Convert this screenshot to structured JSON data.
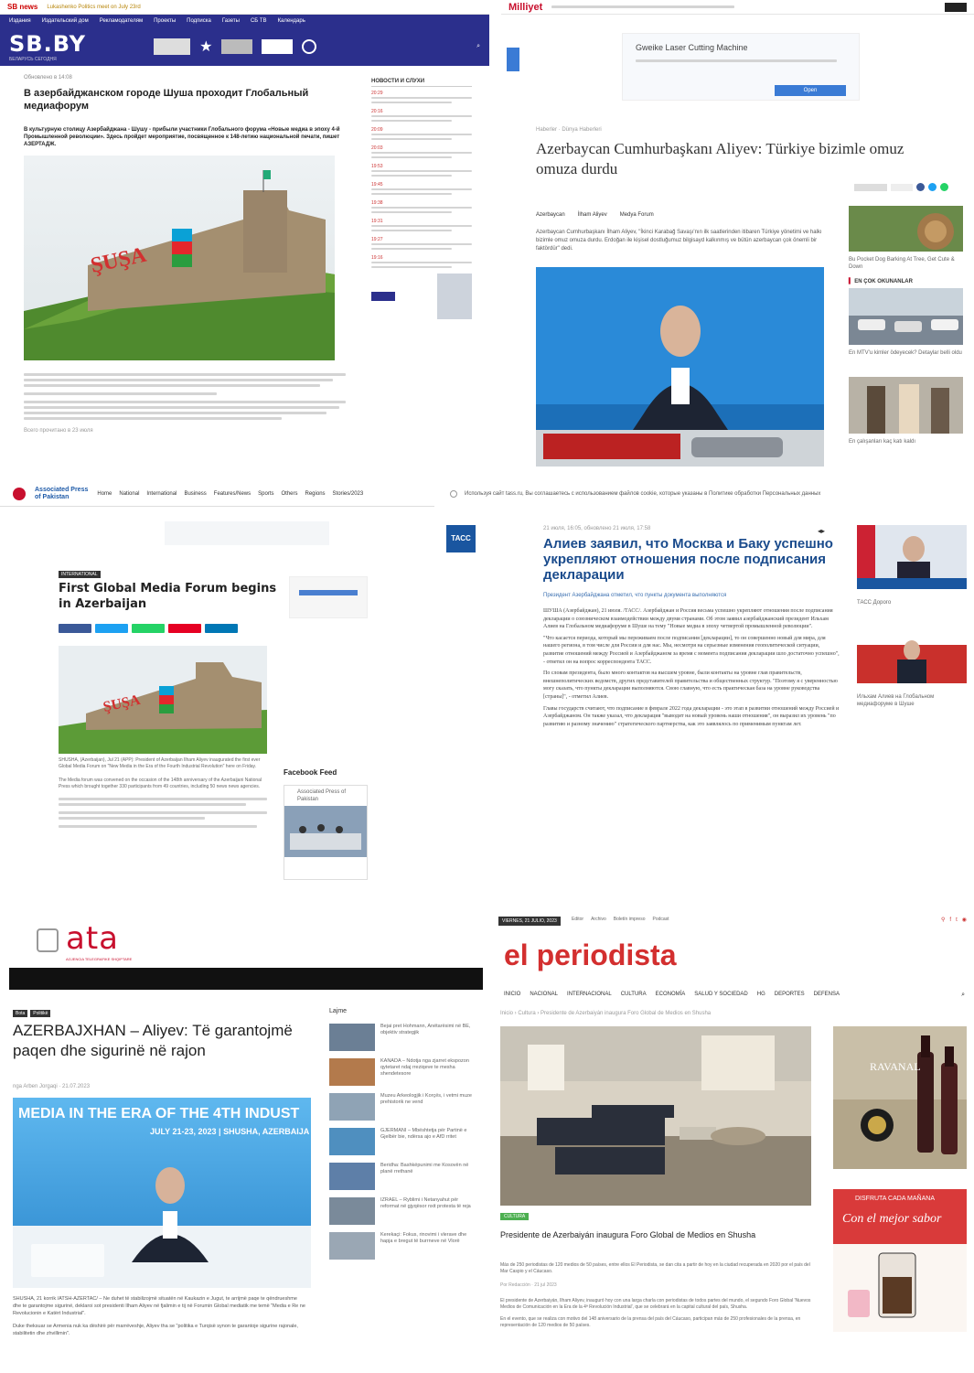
{
  "panel_sbby": {
    "topbar_logo": "SB news",
    "topbar_ticker": "Lukashenko Politics meet on July 23rd",
    "nav": [
      "Издания",
      "Издательский дом",
      "Рекламодателям",
      "Проекты",
      "Подписка",
      "Газеты",
      "СБ ТВ",
      "Календарь"
    ],
    "brand": "SB.BY",
    "brand_tag": "БЕЛАРУСЬ СЕГОДНЯ",
    "crumb": "Обновлено в 14:08",
    "title": "В азербайджанском городе Шуша проходит Глобальный медиафорум",
    "lead": "В культурную столицу Азербайджана - Шушу - прибыли участники Глобального форума «Новые медиа в эпоху 4-й Промышленной революции». Здесь пройдет мероприятие, посвященное к 148-летию национальной печати, пишет АЗЕРТАДЖ.",
    "side_header": "НОВОСТИ И СЛУХИ",
    "side_times": [
      "20:29",
      "20:16",
      "20:09",
      "20:03",
      "19:53",
      "19:45",
      "19:38",
      "19:31",
      "19:27",
      "19:16"
    ],
    "body_foot": "Всего прочитано в 23 июля"
  },
  "panel_milliyet": {
    "logo": "Milliyet",
    "ad_title": "Gweike Laser Cutting Machine",
    "ad_button": "Open",
    "crumb": "Haberler · Dünya Haberleri",
    "title": "Azerbaycan Cumhurbaşkanı Aliyev: Türkiye bizimle omuz omuza durdu",
    "cats": [
      "Azerbaycan",
      "İlham Aliyev",
      "Medya Forum"
    ],
    "body": "Azerbaycan Cumhurbaşkanı İlham Aliyev, \"İkinci Karabağ Savaşı'nın ilk saatlerinden itibaren Türkiye yönetimi ve halkı bizimle omuz omuza durdu. Erdoğan ile kişisel dostluğumuz bilgisayd kalkınmış ve bütün azerbaycan çok önemli bir faktördür\" dedi.",
    "side_heading": "EN ÇOK OKUNANLAR",
    "side_caption_1": "Bu Pocket Dog Barking At Tree, Get Cute & Down",
    "side_caption_2": "En MTV'u kimler ödeyecek? Detaylar belli oldu",
    "side_caption_3": "En çalışanları kaç katı kaldı"
  },
  "panel_app": {
    "logo_line1": "Associated Press",
    "logo_line2": "of Pakistan",
    "nav": [
      "Home",
      "National",
      "International",
      "Business",
      "Features/News",
      "Sports",
      "Others",
      "Regions",
      "Stories/2023"
    ],
    "kicker": "INTERNATIONAL",
    "title": "First Global Media Forum begins in Azerbaijan",
    "facebook": "Facebook Feed",
    "fb_page": "Associated Press of Pakistan",
    "body": "SHUSHA, (Azerbaijan), Jul 21 (APP): President of Azerbaijan Ilham Aliyev inaugurated the first ever Global Media Forum on \"New Media in the Era of the Fourth Industrial Revolution\" here on Friday.",
    "body_2": "The Media forum was convened on the occasion of the 148th anniversary of the Azerbaijani National Press which brought together 330 participants from 49 countries, including 50 news news agencies."
  },
  "panel_tass": {
    "cookie": "Используя сайт tass.ru, Вы соглашаетесь с использованием файлов cookie, которые указаны в Политике обработки Персональных данных",
    "logo": "ТАСС",
    "dateline": "21 июля, 16:05, обновлено 21 июля, 17:58",
    "title": "Алиев заявил, что Москва и Баку успешно укрепляют отношения после подписания декларации",
    "sub": "Президент Азербайджана отметил, что пункты документа выполняются",
    "p1": "ШУША (Азербайджан), 21 июля. /ТАСС/. Азербайджан и Россия весьма успешно укрепляют отношения после подписания декларации о союзническом взаимодействии между двумя странами. Об этом заявил азербайджанский президент Ильхам Алиев на Глобальном медиафоруме в Шуше на тему \"Новые медиа в эпоху четвертой промышленной революции\".",
    "p2": "\"Что касается периода, который мы переживаем после подписания [декларации], то он совершенно новый для мира, для нашего региона, в том числе для России и для нас. Мы, несмотря на серьезные изменения геополитической ситуации, развитие отношений между Россией и Азербайджаном за время с момента подписания декларации шло достаточно успешно\", - ответил он на вопрос корреспондента ТАСС.",
    "p3": "По словам президента, было много контактов на высшем уровне, были контакты на уровне глав правительств, внешнеполитических ведомств, других представителей правительства и общественных структур. \"Поэтому я с уверенностью могу сказать, что пункты декларации выполняются. Свою главную, что есть практическая база на уровне руководства [страны]\", - отметил Алиев.",
    "p4": "Главы государств считают, что подписание в феврале 2022 года декларации - это этап в развитии отношений между Россией и Азербайджаном. Он также указал, что декларация \"выводит на новый уровень наши отношения\", он выразил их уровень \"по развитию и разному значению\" стратегического партнерства, как это заявлялось по применимым пунктам лет.",
    "side_caption_1": "ТАСС Дорого",
    "side_caption_2": "Ильхам Алиев на Глобальном медиафоруме в Шуше"
  },
  "panel_ata": {
    "logo": "ata",
    "logo_sub": "AGJENCIA TELEGRAFIKE SHQIPTARE",
    "tags": [
      "Bota",
      "Politikë"
    ],
    "title": "AZERBAJXHAN – Aliyev: Të garantojmë paqen dhe sigurinë në rajon",
    "byline": "nga Arben Jorgaqi · 21.07.2023",
    "banner_l1": "MEDIA IN THE ERA OF THE 4TH INDUST",
    "banner_l2": "JULY 21-23, 2023 | SHUSHA, AZERBAIJA",
    "side_heading": "Lajme",
    "side_items": [
      "Bejai pret Hohmann, Anëtarësimi në BE, objektiv strategjik",
      "KANADA – Ndotja nga zjarret ekspozon qytetaret ndaj rreziqeve te mesha shendetesore",
      "Muzeu Arkeologjik i Korçës, i vetmi muze prehistorik ne vend",
      "GJERMANI – Mbështetja për Partinë e Gjelbër bie, ndërsa ajo e AfD rritet",
      "Beridha: Bashkëpunimi me Kosovën në planë rrethanë",
      "IZRAEL – Ryblimi i Netanyahut për reformat në gjyqësor nxit protesta të reja",
      "Kerekaçi: Fokus, rinovimi i vlerave dhe hapja e bregut të burrneve në Vlorë"
    ],
    "body": "SHUSHA, 21 korrik /ATSH-AZERTAC/ – Ne duhet të stabilizojmë situatën në Kaukazin e Jugut, te arrijmë paqe te qëndrueshme dhe te garantojme sigurinë, deklaroi sot presidenti Ilham Aliyev në fjalimin e tij në Forumin Global mediatik me temë \"Media e Re ne Revolucionin e Katërt Industrial\".",
    "body_2": "Duke theksuar se Armenia nuk ka dëshirë për marrëveshje, Aliyev tha se \"politika e Turqisë synon te garantoje sigurine rajonale, stabilitetin dhe zhvillimin\"."
  },
  "panel_periodista": {
    "date": "VIERNES, 21 JULIO, 2023",
    "top_links": [
      "Editor",
      "Archivo",
      "Boletín impreso",
      "Podcast"
    ],
    "logo": "el periodista",
    "nav": [
      "INICIO",
      "NACIONAL",
      "INTERNACIONAL",
      "CULTURA",
      "ECONOMÍA",
      "SALUD Y SOCIEDAD",
      "HG",
      "DEPORTES",
      "DEFENSA"
    ],
    "crumb": "Inicio › Cultura › Presidente de Azerbaiyán inaugura Foro Global de Medios en Shusha",
    "tag": "CULTURA",
    "title": "Presidente de Azerbaiyán inaugura Foro Global de Medios en Shusha",
    "lead": "Más de 250 periodistas de 120 medios de 50 países, entre ellos El Periodista, se dan cita a partir de hoy en la ciudad recuperada en 2020 por el país del Mar Caspio y el Cáucaso.",
    "byline": "Por Redacción · 21 jul 2023",
    "body": "El presidente de Azerbaiyán, Ilham Aliyev, inauguró hoy con una larga charla con periodistas de todos partes del mundo, el segundo Foro Global 'Nuevos Medios de Comunicación en la Era de la 4ª Revolución Industrial', que se celebrará en la capital cultural del país, Shusha.",
    "body_2": "En el evento, que se realiza con motivo del 148 aniversario de la prensa del país del Cáucaso, participan más de 250 profesionales de la prensa, en representación de 120 medios de 50 países.",
    "ad_brand": "RAVANAL",
    "ad_slogan_top": "DISFRUTA CADA MAÑANA",
    "ad_slogan": "Con el mejor sabor"
  },
  "colors": {
    "sbby_blue": "#2b2f8c",
    "milliyet_red": "#c8102e",
    "tass_blue": "#1a56a0",
    "ata_red": "#c8102e",
    "periodista_red": "#d32f2f"
  }
}
